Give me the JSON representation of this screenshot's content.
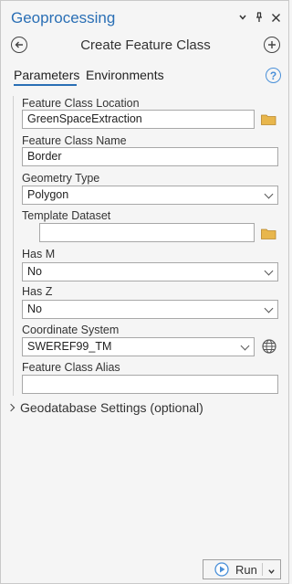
{
  "titlebar": {
    "title": "Geoprocessing",
    "icons": [
      "chevron-down-icon",
      "pin-icon",
      "close-icon"
    ]
  },
  "nav": {
    "tool_title": "Create Feature Class",
    "back_icon": "back-arrow-icon",
    "add_icon": "add-plus-icon"
  },
  "tabs": {
    "parameters": "Parameters",
    "environments": "Environments",
    "help_glyph": "?"
  },
  "form": {
    "location_label": "Feature Class Location",
    "location_value": "GreenSpaceExtraction",
    "name_label": "Feature Class Name",
    "name_value": "Border",
    "geometry_label": "Geometry Type",
    "geometry_value": "Polygon",
    "template_label": "Template Dataset",
    "template_value": "",
    "hasm_label": "Has M",
    "hasm_value": "No",
    "hasz_label": "Has Z",
    "hasz_value": "No",
    "coord_label": "Coordinate System",
    "coord_value": "SWEREF99_TM",
    "alias_label": "Feature Class Alias",
    "alias_value": ""
  },
  "geodatabase_settings": "Geodatabase Settings (optional)",
  "run": {
    "label": "Run",
    "colors": {
      "accent": "#2a6fb5",
      "play": "#4a90d9"
    }
  }
}
